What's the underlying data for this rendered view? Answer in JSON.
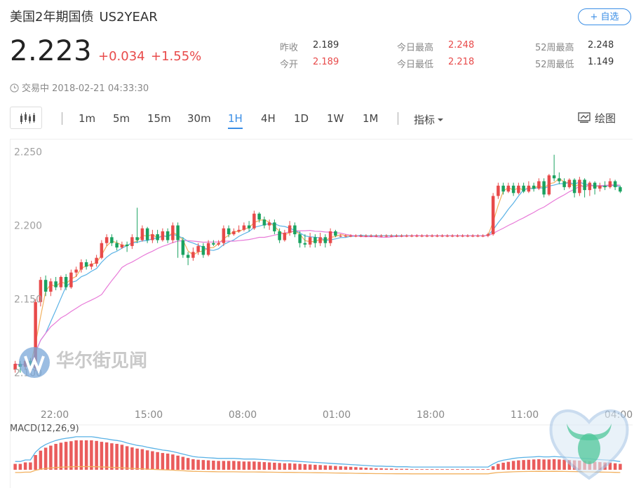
{
  "header": {
    "name": "美国2年期国债",
    "code": "US2YEAR",
    "add_label": "+ 自选"
  },
  "quote": {
    "price": "2.223",
    "change": "+0.034",
    "change_pct": "+1.55%",
    "status_text": "交易中 2018-02-21 04:33:30"
  },
  "stats": {
    "prev_close_label": "昨收",
    "prev_close": "2.189",
    "open_label": "今开",
    "open": "2.189",
    "high_label": "今日最高",
    "high": "2.248",
    "low_label": "今日最低",
    "low": "2.218",
    "w52_high_label": "52周最高",
    "w52_high": "2.248",
    "w52_low_label": "52周最低",
    "w52_low": "1.149"
  },
  "toolbar": {
    "periods": [
      "1m",
      "5m",
      "15m",
      "30m",
      "1H",
      "4H",
      "1D",
      "1W",
      "1M"
    ],
    "active_period": "1H",
    "indicator_label": "指标",
    "draw_label": "绘图"
  },
  "colors": {
    "up": "#e84a4a",
    "down": "#1aa260",
    "accent": "#3a8ee6"
  },
  "watermark": {
    "text": "华尔街见闻"
  },
  "macd": {
    "label": "MACD(12,26,9)"
  },
  "chart_data": {
    "type": "candlestick",
    "y_ticks": [
      "2.250",
      "2.200",
      "2.150",
      "2.100"
    ],
    "ylim": [
      2.095,
      2.255
    ],
    "x_ticks": [
      "22:00",
      "15:00",
      "08:00",
      "01:00",
      "18:00",
      "11:00",
      "04:00"
    ],
    "candles": [
      [
        2.102,
        2.106,
        2.108,
        2.1
      ],
      [
        2.106,
        2.104,
        2.108,
        2.1
      ],
      [
        2.104,
        2.108,
        2.11,
        2.102
      ],
      [
        2.108,
        2.103,
        2.11,
        2.1
      ],
      [
        2.103,
        2.148,
        2.15,
        2.101
      ],
      [
        2.148,
        2.163,
        2.165,
        2.145
      ],
      [
        2.163,
        2.155,
        2.166,
        2.152
      ],
      [
        2.155,
        2.162,
        2.164,
        2.152
      ],
      [
        2.162,
        2.158,
        2.165,
        2.156
      ],
      [
        2.158,
        2.165,
        2.166,
        2.156
      ],
      [
        2.165,
        2.158,
        2.167,
        2.156
      ],
      [
        2.158,
        2.168,
        2.17,
        2.157
      ],
      [
        2.168,
        2.17,
        2.172,
        2.165
      ],
      [
        2.17,
        2.175,
        2.177,
        2.168
      ],
      [
        2.175,
        2.172,
        2.177,
        2.17
      ],
      [
        2.172,
        2.174,
        2.176,
        2.17
      ],
      [
        2.174,
        2.178,
        2.18,
        2.172
      ],
      [
        2.178,
        2.188,
        2.19,
        2.177
      ],
      [
        2.188,
        2.192,
        2.194,
        2.186
      ],
      [
        2.192,
        2.188,
        2.194,
        2.186
      ],
      [
        2.188,
        2.185,
        2.19,
        2.183
      ],
      [
        2.185,
        2.187,
        2.189,
        2.184
      ],
      [
        2.187,
        2.186,
        2.189,
        2.182
      ],
      [
        2.186,
        2.192,
        2.194,
        2.184
      ],
      [
        2.192,
        2.19,
        2.212,
        2.188
      ],
      [
        2.19,
        2.198,
        2.2,
        2.189
      ],
      [
        2.198,
        2.19,
        2.199,
        2.188
      ],
      [
        2.19,
        2.194,
        2.197,
        2.188
      ],
      [
        2.194,
        2.19,
        2.197,
        2.188
      ],
      [
        2.19,
        2.196,
        2.198,
        2.189
      ],
      [
        2.196,
        2.19,
        2.198,
        2.188
      ],
      [
        2.19,
        2.2,
        2.202,
        2.188
      ],
      [
        2.2,
        2.19,
        2.202,
        2.178
      ],
      [
        2.19,
        2.18,
        2.192,
        2.178
      ],
      [
        2.18,
        2.178,
        2.182,
        2.173
      ],
      [
        2.178,
        2.182,
        2.185,
        2.176
      ],
      [
        2.182,
        2.186,
        2.188,
        2.18
      ],
      [
        2.186,
        2.18,
        2.188,
        2.178
      ],
      [
        2.18,
        2.188,
        2.19,
        2.179
      ],
      [
        2.188,
        2.187,
        2.19,
        2.186
      ],
      [
        2.187,
        2.188,
        2.19,
        2.186
      ],
      [
        2.188,
        2.198,
        2.2,
        2.186
      ],
      [
        2.198,
        2.194,
        2.2,
        2.192
      ],
      [
        2.194,
        2.196,
        2.198,
        2.193
      ],
      [
        2.196,
        2.197,
        2.2,
        2.195
      ],
      [
        2.197,
        2.2,
        2.202,
        2.196
      ],
      [
        2.2,
        2.198,
        2.203,
        2.196
      ],
      [
        2.198,
        2.208,
        2.21,
        2.197
      ],
      [
        2.208,
        2.204,
        2.209,
        2.202
      ],
      [
        2.204,
        2.2,
        2.206,
        2.198
      ],
      [
        2.2,
        2.202,
        2.204,
        2.197
      ],
      [
        2.202,
        2.196,
        2.204,
        2.194
      ],
      [
        2.196,
        2.19,
        2.198,
        2.188
      ],
      [
        2.19,
        2.195,
        2.197,
        2.189
      ],
      [
        2.195,
        2.2,
        2.203,
        2.193
      ],
      [
        2.2,
        2.194,
        2.202,
        2.192
      ],
      [
        2.194,
        2.188,
        2.196,
        2.185
      ],
      [
        2.188,
        2.187,
        2.194,
        2.185
      ],
      [
        2.187,
        2.192,
        2.195,
        2.185
      ],
      [
        2.192,
        2.188,
        2.194,
        2.185
      ],
      [
        2.188,
        2.192,
        2.195,
        2.186
      ],
      [
        2.192,
        2.188,
        2.194,
        2.185
      ],
      [
        2.188,
        2.196,
        2.198,
        2.186
      ],
      [
        2.196,
        2.193,
        2.197,
        2.192
      ],
      [
        2.193,
        2.193,
        2.194,
        2.192
      ],
      [
        2.193,
        2.193,
        2.194,
        2.192
      ],
      [
        2.193,
        2.193,
        2.194,
        2.192
      ],
      [
        2.193,
        2.193,
        2.194,
        2.192
      ],
      [
        2.193,
        2.193,
        2.194,
        2.192
      ],
      [
        2.193,
        2.193,
        2.194,
        2.192
      ],
      [
        2.193,
        2.193,
        2.194,
        2.192
      ],
      [
        2.193,
        2.193,
        2.194,
        2.192
      ],
      [
        2.193,
        2.193,
        2.194,
        2.192
      ],
      [
        2.193,
        2.193,
        2.194,
        2.192
      ],
      [
        2.193,
        2.193,
        2.194,
        2.192
      ],
      [
        2.193,
        2.193,
        2.194,
        2.192
      ],
      [
        2.193,
        2.193,
        2.194,
        2.192
      ],
      [
        2.193,
        2.193,
        2.194,
        2.192
      ],
      [
        2.193,
        2.193,
        2.194,
        2.192
      ],
      [
        2.193,
        2.193,
        2.194,
        2.192
      ],
      [
        2.193,
        2.193,
        2.194,
        2.192
      ],
      [
        2.193,
        2.193,
        2.194,
        2.192
      ],
      [
        2.193,
        2.193,
        2.194,
        2.192
      ],
      [
        2.193,
        2.193,
        2.194,
        2.192
      ],
      [
        2.193,
        2.193,
        2.194,
        2.192
      ],
      [
        2.193,
        2.193,
        2.194,
        2.192
      ],
      [
        2.193,
        2.193,
        2.194,
        2.192
      ],
      [
        2.193,
        2.193,
        2.194,
        2.192
      ],
      [
        2.193,
        2.193,
        2.194,
        2.192
      ],
      [
        2.193,
        2.193,
        2.194,
        2.192
      ],
      [
        2.193,
        2.193,
        2.194,
        2.192
      ],
      [
        2.193,
        2.193,
        2.194,
        2.192
      ],
      [
        2.193,
        2.193,
        2.194,
        2.192
      ],
      [
        2.193,
        2.194,
        2.195,
        2.192
      ],
      [
        2.194,
        2.22,
        2.222,
        2.193
      ],
      [
        2.22,
        2.227,
        2.229,
        2.218
      ],
      [
        2.227,
        2.223,
        2.229,
        2.221
      ],
      [
        2.223,
        2.227,
        2.229,
        2.222
      ],
      [
        2.227,
        2.222,
        2.229,
        2.22
      ],
      [
        2.222,
        2.227,
        2.229,
        2.221
      ],
      [
        2.227,
        2.223,
        2.229,
        2.222
      ],
      [
        2.223,
        2.227,
        2.23,
        2.222
      ],
      [
        2.227,
        2.225,
        2.229,
        2.223
      ],
      [
        2.225,
        2.23,
        2.232,
        2.224
      ],
      [
        2.23,
        2.221,
        2.232,
        2.219
      ],
      [
        2.221,
        2.234,
        2.235,
        2.22
      ],
      [
        2.234,
        2.232,
        2.248,
        2.23
      ],
      [
        2.232,
        2.23,
        2.236,
        2.228
      ],
      [
        2.23,
        2.226,
        2.232,
        2.224
      ],
      [
        2.226,
        2.231,
        2.232,
        2.225
      ],
      [
        2.231,
        2.222,
        2.232,
        2.219
      ],
      [
        2.222,
        2.231,
        2.233,
        2.22
      ],
      [
        2.231,
        2.224,
        2.232,
        2.219
      ],
      [
        2.224,
        2.229,
        2.23,
        2.22
      ],
      [
        2.229,
        2.225,
        2.23,
        2.221
      ],
      [
        2.225,
        2.227,
        2.229,
        2.223
      ],
      [
        2.227,
        2.226,
        2.23,
        2.224
      ],
      [
        2.226,
        2.23,
        2.232,
        2.225
      ],
      [
        2.23,
        2.226,
        2.231,
        2.224
      ],
      [
        2.226,
        2.223,
        2.227,
        2.222
      ]
    ],
    "macd": [
      0.2,
      0.2,
      0.25,
      0.25,
      0.5,
      0.65,
      0.75,
      0.82,
      0.88,
      0.92,
      0.95,
      0.97,
      1.0,
      1.0,
      1.0,
      1.0,
      0.98,
      0.95,
      0.93,
      0.9,
      0.88,
      0.85,
      0.8,
      0.76,
      0.72,
      0.7,
      0.66,
      0.63,
      0.6,
      0.57,
      0.55,
      0.52,
      0.48,
      0.44,
      0.4,
      0.36,
      0.34,
      0.33,
      0.32,
      0.31,
      0.3,
      0.3,
      0.3,
      0.3,
      0.29,
      0.28,
      0.28,
      0.28,
      0.27,
      0.26,
      0.25,
      0.24,
      0.23,
      0.22,
      0.22,
      0.21,
      0.2,
      0.19,
      0.18,
      0.17,
      0.16,
      0.15,
      0.14,
      0.13,
      0.12,
      0.11,
      0.1,
      0.09,
      0.08,
      0.07,
      0.06,
      0.05,
      0.05,
      0.04,
      0.04,
      0.03,
      0.03,
      0.03,
      0.02,
      0.02,
      0.02,
      0.02,
      0.02,
      0.02,
      0.02,
      0.02,
      0.02,
      0.02,
      0.02,
      0.02,
      0.02,
      0.02,
      0.02,
      0.02,
      0.12,
      0.2,
      0.24,
      0.27,
      0.3,
      0.32,
      0.33,
      0.34,
      0.35,
      0.36,
      0.35,
      0.35,
      0.36,
      0.35,
      0.34,
      0.33,
      0.32,
      0.31,
      0.3,
      0.29,
      0.27,
      0.26,
      0.25,
      0.24,
      0.22,
      0.2
    ]
  }
}
